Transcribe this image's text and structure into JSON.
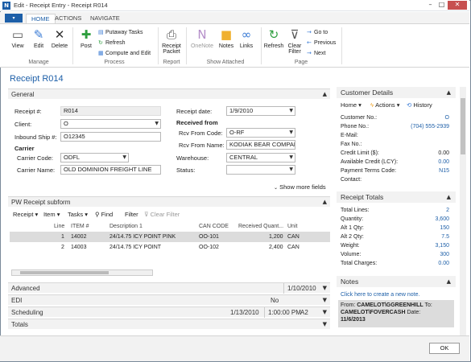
{
  "window": {
    "title": "Edit - Receipt Entry - Receipt R014",
    "logo_text": "N",
    "minimize": "–",
    "maximize": "□",
    "close": "✕"
  },
  "tabs": {
    "menu_icon": "▾",
    "items": [
      "HOME",
      "ACTIONS",
      "NAVIGATE"
    ]
  },
  "ribbon": {
    "view": "View",
    "edit": "Edit",
    "delete": "Delete",
    "post": "Post",
    "putaway_tasks": "Putaway Tasks",
    "refresh_small": "Refresh",
    "compute_edit": "Compute and Edit",
    "receipt_packet_1": "Receipt",
    "receipt_packet_2": "Packet",
    "onenote": "OneNote",
    "notes": "Notes",
    "links": "Links",
    "refresh": "Refresh",
    "clear_filter_1": "Clear",
    "clear_filter_2": "Filter",
    "go_to": "Go to",
    "previous": "Previous",
    "next": "Next",
    "groups": {
      "manage": "Manage",
      "process": "Process",
      "report": "Report",
      "show_attached": "Show Attached",
      "page": "Page"
    }
  },
  "page_title": "Receipt R014",
  "general": {
    "header": "General",
    "receipt_no_label": "Receipt #:",
    "receipt_no": "R014",
    "client_label": "Client:",
    "client": "O",
    "inbound_ship_label": "Inbound Ship #:",
    "inbound_ship": "O12345",
    "carrier_heading": "Carrier",
    "carrier_code_label": "Carrier Code:",
    "carrier_code": "ODFL",
    "carrier_name_label": "Carrier Name:",
    "carrier_name": "OLD DOMINION FREIGHT LINE",
    "receipt_date_label": "Receipt date:",
    "receipt_date": "1/9/2010",
    "received_from_heading": "Received from",
    "rcv_from_code_label": "Rcv From Code:",
    "rcv_from_code": "O-RF",
    "rcv_from_name_label": "Rcv From Name:",
    "rcv_from_name": "KODIAK BEAR COMPANY",
    "warehouse_label": "Warehouse:",
    "warehouse": "CENTRAL",
    "status_label": "Status:",
    "status": "",
    "show_more": "Show more fields"
  },
  "subform": {
    "header": "PW Receipt subform",
    "toolbar": {
      "receipt": "Receipt",
      "item": "Item",
      "tasks": "Tasks",
      "find": "Find",
      "filter": "Filter",
      "clear_filter": "Clear Filter"
    },
    "columns": [
      "Line",
      "ITEM #",
      "Description 1",
      "CAN CODE",
      "Received Quant...",
      "Unit"
    ],
    "rows": [
      {
        "line": "1",
        "item": "14002",
        "desc": "24/14.75 ICY POINT PINK",
        "can": "OO-101",
        "qty": "1,200",
        "unit": "CAN"
      },
      {
        "line": "2",
        "item": "14003",
        "desc": "24/14.75 ICY POINT",
        "can": "OO-102",
        "qty": "2,400",
        "unit": "CAN"
      }
    ]
  },
  "collapsed": {
    "advanced": {
      "label": "Advanced",
      "value": "1/10/2010"
    },
    "edi": {
      "label": "EDI",
      "value": "No"
    },
    "scheduling": {
      "label": "Scheduling",
      "value1": "1/13/2010",
      "value2": "1:00:00 PM",
      "value3": "A2"
    },
    "totals": {
      "label": "Totals"
    }
  },
  "customer_details": {
    "header": "Customer Details",
    "toolbar": {
      "home": "Home",
      "actions": "Actions",
      "history": "History"
    },
    "rows": [
      {
        "label": "Customer No.:",
        "value": "O"
      },
      {
        "label": "Phone No.:",
        "value": "(704) 555-2939"
      },
      {
        "label": "E-Mail:",
        "value": ""
      },
      {
        "label": "Fax No.:",
        "value": ""
      },
      {
        "label": "Credit Limit ($):",
        "value": "0.00"
      },
      {
        "label": "Available Credit (LCY):",
        "value": "0.00"
      },
      {
        "label": "Payment Terms Code:",
        "value": "N15"
      },
      {
        "label": "Contact:",
        "value": ""
      }
    ]
  },
  "receipt_totals": {
    "header": "Receipt Totals",
    "rows": [
      {
        "label": "Total Lines:",
        "value": "2"
      },
      {
        "label": "Quantity:",
        "value": "3,600"
      },
      {
        "label": "Alt 1 Qty:",
        "value": "150"
      },
      {
        "label": "Alt 2 Qty:",
        "value": "7.5"
      },
      {
        "label": "Weight:",
        "value": "3,150"
      },
      {
        "label": "Volume:",
        "value": "300"
      },
      {
        "label": "Total Charges:",
        "value": "0.00"
      }
    ]
  },
  "notes": {
    "header": "Notes",
    "create_link": "Click here to create a new note.",
    "from_label": "From:",
    "from": "CAMELOT\\GGREENHILL",
    "to_label": "To:",
    "to": "CAMELOT\\FOVERCASH",
    "date_label": "Date:",
    "date": "11/6/2013"
  },
  "ok_button": "OK"
}
